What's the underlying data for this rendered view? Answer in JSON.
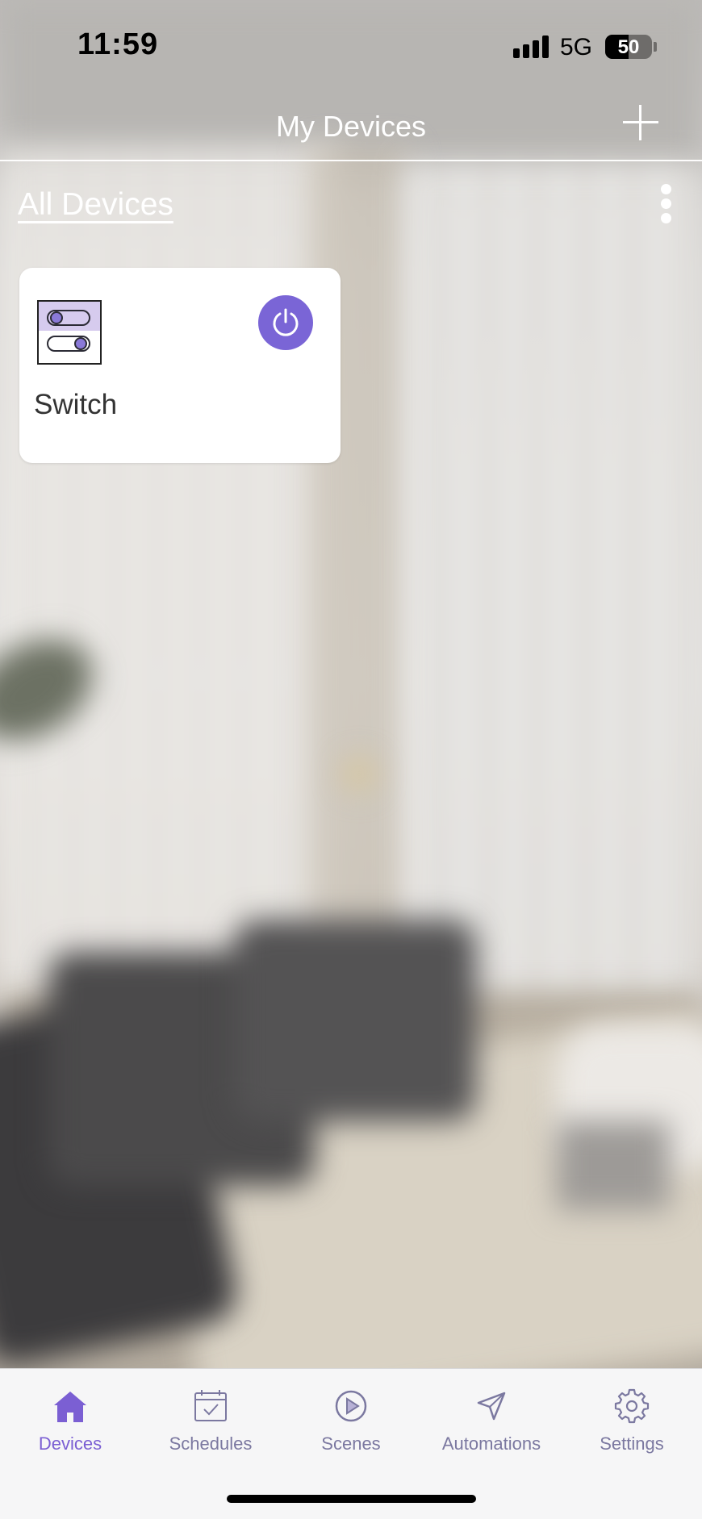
{
  "status_bar": {
    "time": "11:59",
    "network": "5G",
    "battery_percent": "50",
    "battery_level": 0.5
  },
  "header": {
    "title": "My Devices"
  },
  "section": {
    "title": "All Devices"
  },
  "devices": [
    {
      "name": "Switch",
      "power_on": true
    }
  ],
  "tabbar": {
    "tabs": [
      {
        "label": "Devices",
        "icon": "home-icon",
        "active": true
      },
      {
        "label": "Schedules",
        "icon": "calendar-check-icon",
        "active": false
      },
      {
        "label": "Scenes",
        "icon": "play-circle-icon",
        "active": false
      },
      {
        "label": "Automations",
        "icon": "send-arrow-icon",
        "active": false
      },
      {
        "label": "Settings",
        "icon": "gear-icon",
        "active": false
      }
    ]
  },
  "colors": {
    "accent": "#7a65d6",
    "tab_inactive": "#7b78a0",
    "tab_active": "#7b5fd3"
  }
}
